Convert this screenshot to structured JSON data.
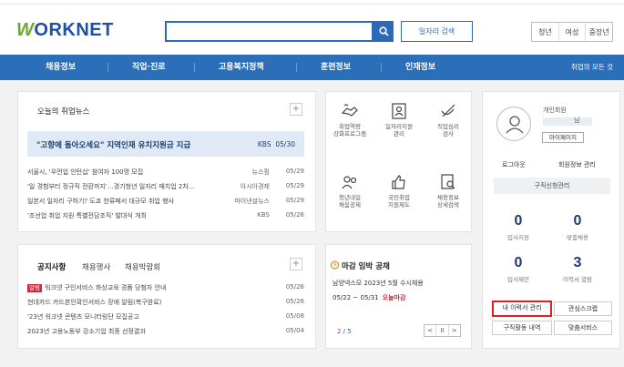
{
  "header": {
    "logo_prefix": "W",
    "logo_rest": "ORKNET",
    "search_placeholder": "",
    "job_search_label": "일자리 검색",
    "segments": [
      "청년",
      "여성",
      "중장년"
    ]
  },
  "nav": {
    "items": [
      "채용정보",
      "직업·진로",
      "고용복지정책",
      "훈련정보",
      "인재정보"
    ],
    "all_label": "취업의 모든 것"
  },
  "news": {
    "title": "오늘의 취업뉴스",
    "highlight": {
      "title": "\"고향에 돌아오세요\" 지역인재 유치지원금 지급",
      "source": "KBS",
      "date": "05/30"
    },
    "rows": [
      {
        "title": "서울시, '우먼업 인턴십' 참여자 100명 모집",
        "source": "뉴스핌",
        "date": "05/29"
      },
      {
        "title": "'일 경험부터 정규직 전환까지'…경기청년 일자리 매치업 2차…",
        "source": "아시아경제",
        "date": "05/29"
      },
      {
        "title": "일본서 일자리 구하기? 도쿄 한류페서 대규모 취업 행사",
        "source": "파이낸셜뉴스",
        "date": "05/29"
      },
      {
        "title": "'조선업 취업 지원 특별전담조직' 발대식 개최",
        "source": "KBS",
        "date": "05/26"
      }
    ]
  },
  "services": [
    {
      "label": "취업역량\n강화프로그램"
    },
    {
      "label": "일자리지원\n관리"
    },
    {
      "label": "직업심리\n검사"
    },
    {
      "label": "청년내일\n채움공제"
    },
    {
      "label": "국민취업\n지원제도"
    },
    {
      "label": "채용정보\n상세검색"
    }
  ],
  "notices": {
    "tabs": [
      "공지사항",
      "채용행사",
      "채용박람회"
    ],
    "badge": "알림",
    "rows": [
      {
        "title": "워크넷 구인서비스 화상교육 경품 당첨자 안내",
        "date": "05/26"
      },
      {
        "title": "현대카드 카드본인확인서비스 장애 알림(복구완료)",
        "date": "05/26"
      },
      {
        "title": "'23년 워크넷 콘텐츠 모니터링단 모집공고",
        "date": "05/08"
      },
      {
        "title": "2023년 고용노동부 강소기업 최종 선정결과",
        "date": "05/04"
      }
    ]
  },
  "deadline": {
    "title": "마감 임박 공채",
    "company": "남양넥스모  2023년 5월 수시채용",
    "date": "05/22 ~ 05/31",
    "today": "오늘마감",
    "pager": "2 / 5",
    "ctrls": [
      "<",
      "II",
      ">"
    ]
  },
  "user": {
    "member_type": "개인회원",
    "name_suffix": "님",
    "mypage": "마이페이지",
    "logout": "로그아웃",
    "manage": "회원정보 관리",
    "apply_manage": "구직신청관리",
    "stats": [
      {
        "num": "0",
        "label": "입사지원"
      },
      {
        "num": "0",
        "label": "맞춤채용"
      },
      {
        "num": "0",
        "label": "입사제안"
      },
      {
        "num": "3",
        "label": "이력서 열람"
      }
    ],
    "quick": [
      "내 이력서 관리",
      "관심스크랩",
      "구직활동 내역",
      "맞춤서비스"
    ]
  },
  "colors": {
    "brand_blue": "#2b6fb8",
    "brand_green": "#6aa82e",
    "highlight_red": "#e02020"
  }
}
